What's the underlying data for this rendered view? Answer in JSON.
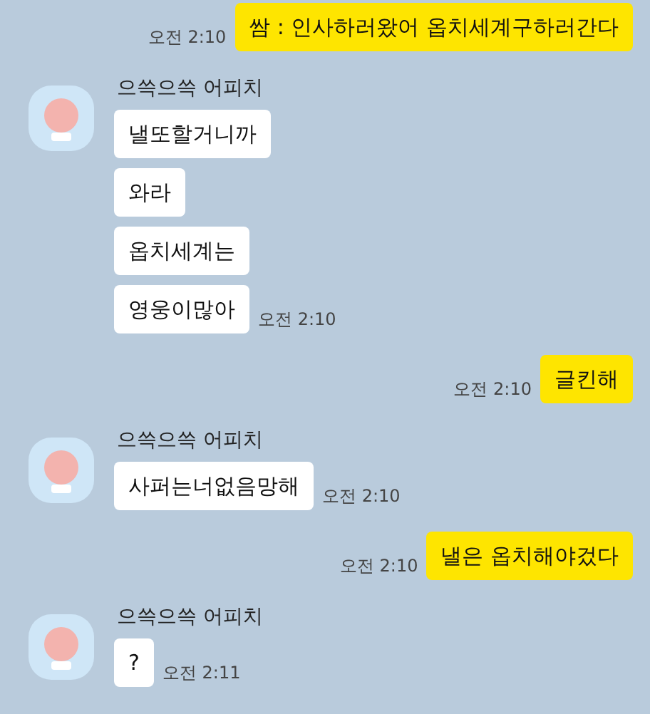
{
  "messages": [
    {
      "kind": "sent",
      "bubbles": [
        "쌈 : 인사하러왔어 옵치세계구하러간다"
      ],
      "time": "오전 2:10"
    },
    {
      "kind": "received",
      "sender": "으쓱으쓱 어피치",
      "bubbles": [
        "낼또할거니까",
        "와라",
        "옵치세계는",
        "영웅이많아"
      ],
      "time": "오전 2:10"
    },
    {
      "kind": "sent",
      "bubbles": [
        "글킨해"
      ],
      "time": "오전 2:10"
    },
    {
      "kind": "received",
      "sender": "으쓱으쓱 어피치",
      "bubbles": [
        "사퍼는너없음망해"
      ],
      "time": "오전 2:10"
    },
    {
      "kind": "sent",
      "bubbles": [
        "낼은 옵치해야겄다"
      ],
      "time": "오전 2:10"
    },
    {
      "kind": "received",
      "sender": "으쓱으쓱 어피치",
      "bubbles": [
        "?"
      ],
      "time": "오전 2:11"
    }
  ]
}
